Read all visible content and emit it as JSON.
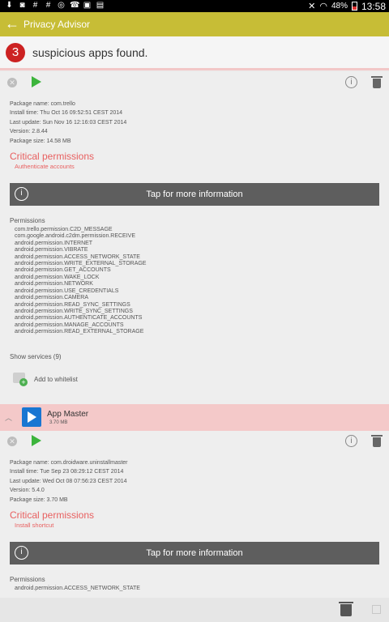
{
  "status_bar": {
    "time": "13:58",
    "battery_pct": "48%"
  },
  "action_bar": {
    "title": "Privacy Advisor"
  },
  "summary": {
    "count": "3",
    "text": "suspicious apps found."
  },
  "apps": [
    {
      "meta": [
        "Package name: com.trello",
        "Install time: Thu Oct 16 09:52:51 CEST 2014",
        "Last update: Sun Nov 16 12:16:03 CEST 2014",
        "Version: 2.8.44",
        "Package size: 14.58 MB"
      ],
      "critical_title": "Critical permissions",
      "critical_items": [
        "Authenticate accounts"
      ],
      "tap_label": "Tap for more information",
      "permissions_title": "Permissions",
      "permissions": [
        "com.trello.permission.C2D_MESSAGE",
        "com.google.android.c2dm.permission.RECEIVE",
        "android.permission.INTERNET",
        "android.permission.VIBRATE",
        "android.permission.ACCESS_NETWORK_STATE",
        "android.permission.WRITE_EXTERNAL_STORAGE",
        "android.permission.GET_ACCOUNTS",
        "android.permission.WAKE_LOCK",
        "android.permission.NETWORK",
        "android.permission.USE_CREDENTIALS",
        "android.permission.CAMERA",
        "android.permission.READ_SYNC_SETTINGS",
        "android.permission.WRITE_SYNC_SETTINGS",
        "android.permission.AUTHENTICATE_ACCOUNTS",
        "android.permission.MANAGE_ACCOUNTS",
        "android.permission.READ_EXTERNAL_STORAGE"
      ],
      "show_services": "Show services (9)",
      "whitelist_label": "Add to whitelist"
    },
    {
      "name": "App Master",
      "size": "3.70 MB",
      "meta": [
        "Package name: com.droidware.uninstallmaster",
        "Install time: Tue Sep 23 08:29:12 CEST 2014",
        "Last update: Wed Oct 08 07:56:23 CEST 2014",
        "Version: 5.4.0",
        "Package size: 3.70 MB"
      ],
      "critical_title": "Critical permissions",
      "critical_items": [
        "Install shortcut"
      ],
      "tap_label": "Tap for more information",
      "permissions_title": "Permissions",
      "permissions": [
        "android.permission.ACCESS_NETWORK_STATE"
      ]
    }
  ]
}
